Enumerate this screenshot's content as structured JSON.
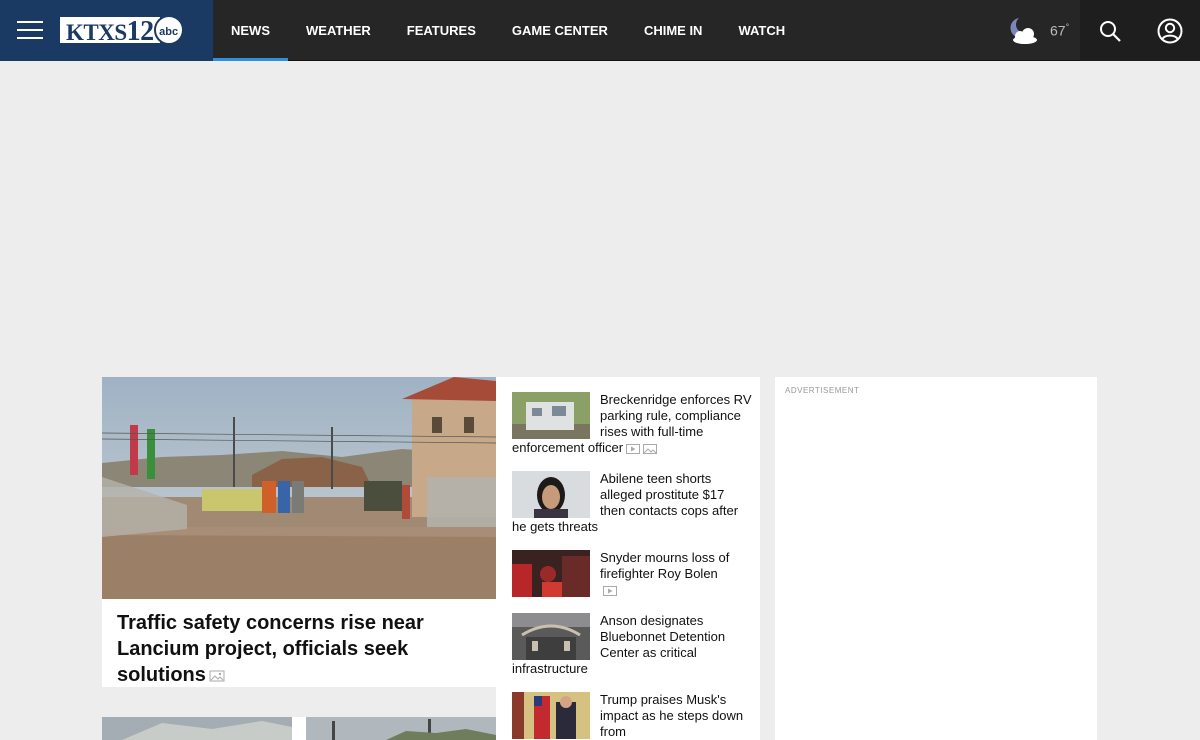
{
  "header": {
    "logo_text": "KTXS",
    "logo_number": "12",
    "logo_network": "abc",
    "nav": [
      {
        "label": "NEWS",
        "active": true
      },
      {
        "label": "WEATHER",
        "active": false
      },
      {
        "label": "FEATURES",
        "active": false
      },
      {
        "label": "GAME CENTER",
        "active": false
      },
      {
        "label": "CHIME IN",
        "active": false
      },
      {
        "label": "WATCH",
        "active": false
      }
    ],
    "weather": {
      "temp": "67",
      "degree": "°",
      "icon": "partly-cloudy-night-icon"
    },
    "colors": {
      "brand": "#1b3a63",
      "active_underline": "#2f8fd8"
    }
  },
  "hero": {
    "title": "Traffic safety concerns rise near Lancium project, officials seek solutions",
    "media_icon": "gallery-icon"
  },
  "stories": [
    {
      "title": "Breckenridge enforces RV parking rule, compliance rises with full-time enforcement officer",
      "icons": [
        "video-icon",
        "gallery-icon"
      ]
    },
    {
      "title": "Abilene teen shorts alleged prostitute $17 then contacts cops after he gets threats",
      "icons": []
    },
    {
      "title": "Snyder mourns loss of firefighter Roy Bolen",
      "icons": [
        "video-icon"
      ]
    },
    {
      "title": "Anson designates Bluebonnet Detention Center as critical infrastructure",
      "icons": []
    },
    {
      "title": "Trump praises Musk's impact as he steps down from",
      "icons": []
    }
  ],
  "ad": {
    "label": "ADVERTISEMENT"
  }
}
